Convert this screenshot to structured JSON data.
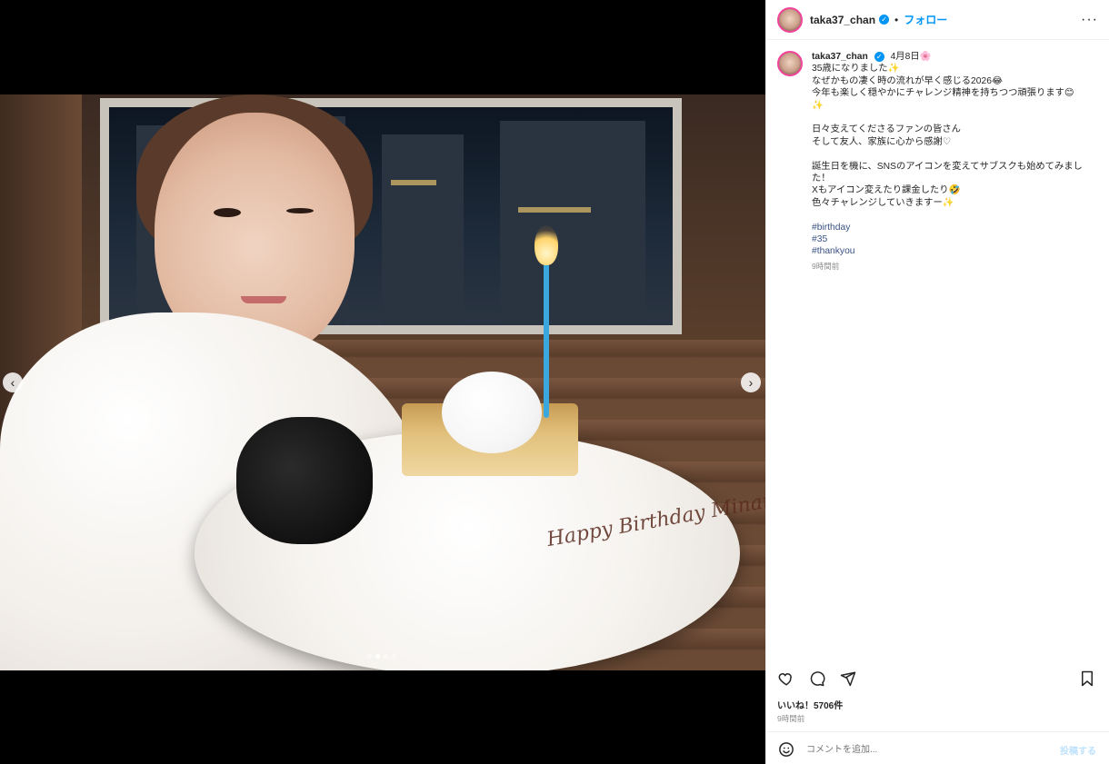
{
  "post": {
    "username": "taka37_chan",
    "verified": true,
    "follow_label": "フォロー",
    "more_icon": "more-horizontal-icon",
    "date": "4月8日🌸",
    "caption_lines": [
      "35歳になりました✨",
      "なぜかもの凄く時の流れが早く感じる2026😂",
      "今年も楽しく穏やかにチャレンジ精神を持ちつつ頑張ります😊",
      "✨",
      "",
      "日々支えてくださるファンの皆さん",
      "そして友人、家族に心から感謝♡",
      "",
      "誕生日を機に、SNSのアイコンを変えてサブスクも始めてみました！",
      "Xもアイコン変えたり課金したり🤣",
      "色々チャレンジしていきますー✨",
      "",
      "#birthday",
      "#35",
      "#thankyou"
    ],
    "caption_time": "9時間前",
    "likes": "いいね！5706件",
    "time": "9時間前",
    "comment_placeholder": "コメントを追加...",
    "post_label": "投稿する",
    "colors": {
      "link": "#0095f6",
      "hashtag": "#385185",
      "muted": "#8e8e8e",
      "post_disabled": "#bfe2fd"
    },
    "carousel": {
      "total_slides": 4,
      "active_index": 1,
      "prev_icon": "chevron-left-icon",
      "next_icon": "chevron-right-icon"
    },
    "photo": {
      "plate_writing": "Happy Birthday Minami"
    },
    "action_icons": [
      "heart-icon",
      "comment-icon",
      "share-icon",
      "bookmark-icon"
    ]
  }
}
